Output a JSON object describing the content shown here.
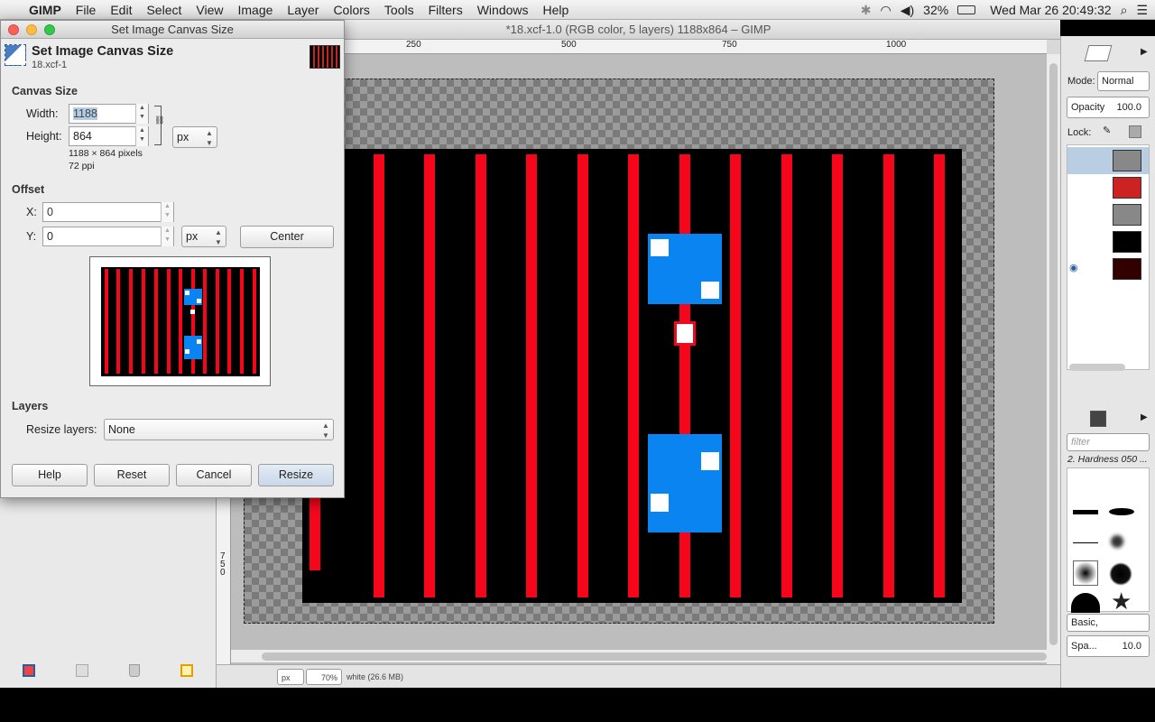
{
  "menubar": {
    "app": "GIMP",
    "items": [
      "File",
      "Edit",
      "Select",
      "View",
      "Image",
      "Layer",
      "Colors",
      "Tools",
      "Filters",
      "Windows",
      "Help"
    ],
    "battery": "32%",
    "datetime": "Wed Mar 26  20:49:32"
  },
  "image_window": {
    "title": "*18.xcf-1.0 (RGB color, 5 layers) 1188x864 – GIMP",
    "ruler_top": [
      "250",
      "500",
      "750",
      "1000"
    ],
    "ruler_left": "750",
    "status_unit": "px",
    "status_zoom": "70%",
    "status_info": "white (26.6 MB)"
  },
  "dialog": {
    "window_title": "Set Image Canvas Size",
    "header_title": "Set Image Canvas Size",
    "header_subtitle": "18.xcf-1",
    "canvas_size_section": "Canvas Size",
    "width_label": "Width:",
    "width_value": "1188",
    "height_label": "Height:",
    "height_value": "864",
    "size_unit": "px",
    "pixels_info": "1188 × 864 pixels",
    "ppi_info": "72 ppi",
    "offset_section": "Offset",
    "x_label": "X:",
    "x_value": "0",
    "y_label": "Y:",
    "y_value": "0",
    "offset_unit": "px",
    "center_button": "Center",
    "layers_section": "Layers",
    "resize_layers_label": "Resize layers:",
    "resize_layers_value": "None",
    "buttons": {
      "help": "Help",
      "reset": "Reset",
      "cancel": "Cancel",
      "resize": "Resize"
    }
  },
  "dock": {
    "mode_label": "Mode:",
    "mode_value": "Normal",
    "opacity_label": "Opacity",
    "opacity_value": "100.0",
    "lock_label": "Lock:",
    "filter_placeholder": "filter",
    "brush_name": "2. Hardness 050 ...",
    "brush_preset": "Basic,",
    "spacing_label": "Spa...",
    "spacing_value": "10.0"
  },
  "colors": {
    "stripe_red": "#f5061b",
    "box_blue": "#0a84f0"
  }
}
